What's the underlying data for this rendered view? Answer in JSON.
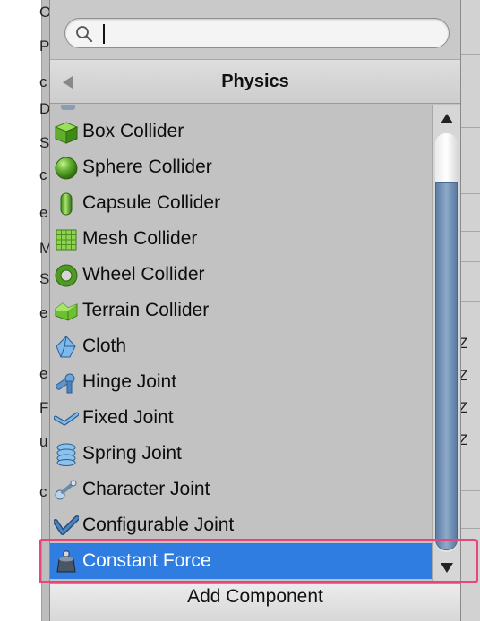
{
  "search": {
    "value": "",
    "placeholder": ""
  },
  "header": {
    "title": "Physics"
  },
  "items": [
    {
      "label": "Box Collider",
      "icon": "box-collider-icon"
    },
    {
      "label": "Sphere Collider",
      "icon": "sphere-collider-icon"
    },
    {
      "label": "Capsule Collider",
      "icon": "capsule-collider-icon"
    },
    {
      "label": "Mesh Collider",
      "icon": "mesh-collider-icon"
    },
    {
      "label": "Wheel Collider",
      "icon": "wheel-collider-icon"
    },
    {
      "label": "Terrain Collider",
      "icon": "terrain-collider-icon"
    },
    {
      "label": "Cloth",
      "icon": "cloth-icon"
    },
    {
      "label": "Hinge Joint",
      "icon": "hinge-joint-icon"
    },
    {
      "label": "Fixed Joint",
      "icon": "fixed-joint-icon"
    },
    {
      "label": "Spring Joint",
      "icon": "spring-joint-icon"
    },
    {
      "label": "Character Joint",
      "icon": "character-joint-icon"
    },
    {
      "label": "Configurable Joint",
      "icon": "configurable-joint-icon"
    },
    {
      "label": "Constant Force",
      "icon": "constant-force-icon",
      "selected": true
    }
  ],
  "footer": {
    "add_component": "Add Component"
  },
  "background": {
    "left_fragments": [
      "O",
      "P",
      "c",
      "D",
      "S",
      "c",
      "e",
      "M",
      "S",
      "e",
      "e",
      "F",
      "u",
      "c"
    ],
    "right_fragments": [
      "Z",
      "Z",
      "Z",
      "Z"
    ]
  },
  "colors": {
    "selection": "#2f7de1",
    "highlight": "#e6467a",
    "scroll_thumb": "#5c7ea6"
  }
}
